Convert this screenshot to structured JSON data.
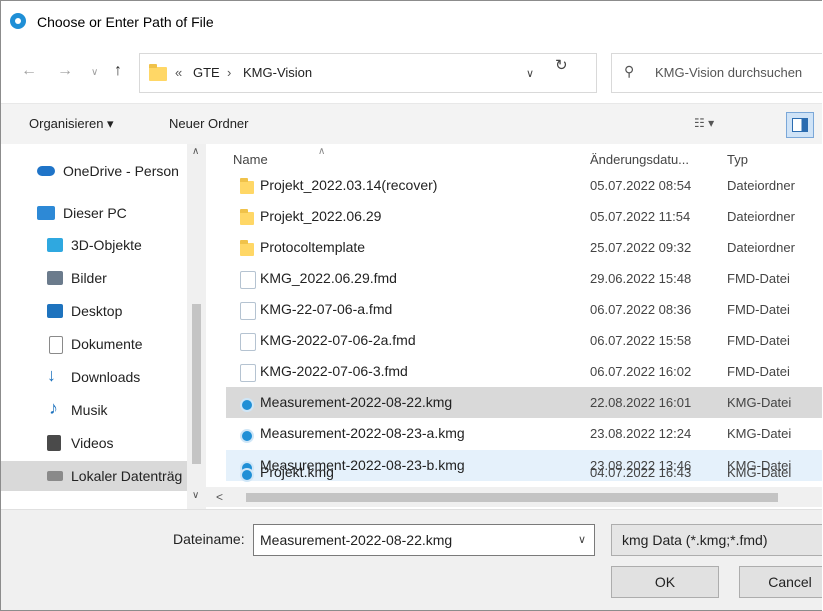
{
  "window": {
    "title": "Choose or Enter Path of File"
  },
  "address": {
    "back_icon": "back-arrow",
    "forward_icon": "forward-arrow",
    "up_icon": "up-arrow",
    "prefix": "«",
    "crumbs": [
      "GTE",
      "KMG-Vision"
    ],
    "refresh_icon": "refresh"
  },
  "search": {
    "placeholder": "KMG-Vision durchsuchen"
  },
  "commandbar": {
    "organize": "Organisieren ▾",
    "new_folder": "Neuer Ordner"
  },
  "nav": {
    "items": [
      {
        "label": "OneDrive - Person",
        "icon": "cloud-icon",
        "color": "#1f74c8"
      },
      {
        "label": "Dieser PC",
        "icon": "pc-icon",
        "color": "#2d89d6"
      },
      {
        "label": "3D-Objekte",
        "icon": "cube-icon",
        "color": "#2fa8e0"
      },
      {
        "label": "Bilder",
        "icon": "pictures-icon",
        "color": "#6b7b8c"
      },
      {
        "label": "Desktop",
        "icon": "desktop-icon",
        "color": "#1e73be"
      },
      {
        "label": "Dokumente",
        "icon": "documents-icon",
        "color": "#8a8a8a"
      },
      {
        "label": "Downloads",
        "icon": "download-icon",
        "color": "#1e73be"
      },
      {
        "label": "Musik",
        "icon": "music-icon",
        "color": "#1e73be"
      },
      {
        "label": "Videos",
        "icon": "video-icon",
        "color": "#4a4a4a"
      },
      {
        "label": "Lokaler Datenträg",
        "icon": "drive-icon",
        "color": "#8a8a8a"
      }
    ]
  },
  "columns": {
    "name": "Name",
    "date": "Änderungsdatu...",
    "type": "Typ"
  },
  "files": [
    {
      "name": "Projekt_2022.03.14(recover)",
      "date": "05.07.2022 08:54",
      "type": "Dateiordner",
      "icon": "folder-icon"
    },
    {
      "name": "Projekt_2022.06.29",
      "date": "05.07.2022 11:54",
      "type": "Dateiordner",
      "icon": "folder-icon"
    },
    {
      "name": "Protocoltemplate",
      "date": "25.07.2022 09:32",
      "type": "Dateiordner",
      "icon": "folder-icon"
    },
    {
      "name": "KMG_2022.06.29.fmd",
      "date": "29.06.2022 15:48",
      "type": "FMD-Datei",
      "icon": "fmd-file-icon"
    },
    {
      "name": "KMG-22-07-06-a.fmd",
      "date": "06.07.2022 08:36",
      "type": "FMD-Datei",
      "icon": "fmd-file-icon"
    },
    {
      "name": "KMG-2022-07-06-2a.fmd",
      "date": "06.07.2022 15:58",
      "type": "FMD-Datei",
      "icon": "fmd-file-icon"
    },
    {
      "name": "KMG-2022-07-06-3.fmd",
      "date": "06.07.2022 16:02",
      "type": "FMD-Datei",
      "icon": "fmd-file-icon"
    },
    {
      "name": "Measurement-2022-08-22.kmg",
      "date": "22.08.2022 16:01",
      "type": "KMG-Datei",
      "icon": "kmg-file-icon"
    },
    {
      "name": "Measurement-2022-08-23-a.kmg",
      "date": "23.08.2022 12:24",
      "type": "KMG-Datei",
      "icon": "kmg-file-icon"
    },
    {
      "name": "Measurement-2022-08-23-b.kmg",
      "date": "23.08.2022 13:46",
      "type": "KMG-Datei",
      "icon": "kmg-file-icon"
    },
    {
      "name": "Projekt.kmg",
      "date": "04.07.2022 16:43",
      "type": "KMG-Datei",
      "icon": "kmg-file-icon"
    }
  ],
  "filename": {
    "label": "Dateiname:",
    "value": "Measurement-2022-08-22.kmg"
  },
  "filetype": {
    "value": "kmg Data (*.kmg;*.fmd)"
  },
  "buttons": {
    "ok": "OK",
    "cancel": "Cancel"
  }
}
